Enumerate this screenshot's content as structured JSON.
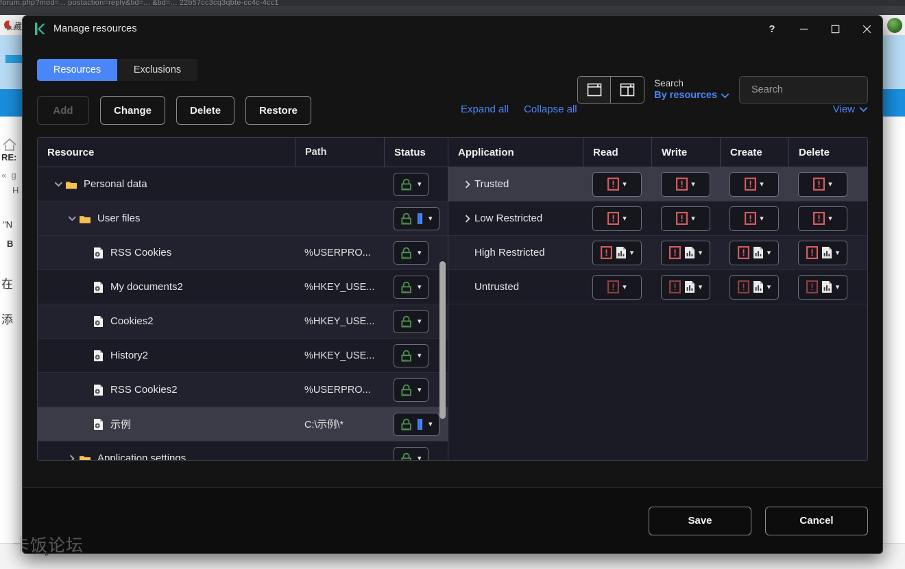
{
  "background": {
    "top_strip_text": "forum.php?mod=... postaction=reply&tid=... &tid=... 22b57cc3cq3qbte-cc4c-4cc1",
    "favorites_label": "收藏",
    "snippets": [
      "RE:",
      "\"N",
      "B",
      "在",
      "添"
    ],
    "watermark": "卡饭论坛"
  },
  "window": {
    "title": "Manage resources",
    "logo_letter": "k",
    "controls": {
      "help": "?",
      "minimize": "—",
      "maximize": "□",
      "close": "✕"
    }
  },
  "tabs": [
    {
      "label": "Resources",
      "active": true
    },
    {
      "label": "Exclusions",
      "active": false
    }
  ],
  "search": {
    "view_single_icon": "single-pane-icon",
    "view_split_icon": "split-pane-icon",
    "label": "Search",
    "mode_value": "By resources",
    "placeholder": "Search",
    "value": ""
  },
  "actions": {
    "add": "Add",
    "add_disabled": true,
    "change": "Change",
    "delete": "Delete",
    "restore": "Restore",
    "expand_all": "Expand all",
    "collapse_all": "Collapse all",
    "view_menu": "View"
  },
  "resource_table": {
    "headers": [
      "Resource",
      "Path",
      "Status"
    ],
    "rows": [
      {
        "name": "Personal data",
        "path": "",
        "indent": 0,
        "icon": "folder-icon",
        "expander": "expanded",
        "status_icons": [
          "lock-green"
        ],
        "shade": "plain"
      },
      {
        "name": "User files",
        "path": "",
        "indent": 1,
        "icon": "folder-icon",
        "expander": "expanded",
        "status_icons": [
          "lock-green",
          "blue-bar"
        ],
        "shade": "alt"
      },
      {
        "name": "RSS Cookies",
        "path": "%USERPRO...",
        "indent": 2,
        "icon": "file-gear-icon",
        "expander": "none",
        "status_icons": [
          "lock-green"
        ],
        "shade": "alt"
      },
      {
        "name": "My documents2",
        "path": "%HKEY_USE...",
        "indent": 2,
        "icon": "file-gear-icon",
        "expander": "none",
        "status_icons": [
          "lock-green"
        ],
        "shade": "plain"
      },
      {
        "name": "Cookies2",
        "path": "%HKEY_USE...",
        "indent": 2,
        "icon": "file-gear-icon",
        "expander": "none",
        "status_icons": [
          "lock-green"
        ],
        "shade": "alt"
      },
      {
        "name": "History2",
        "path": "%HKEY_USE...",
        "indent": 2,
        "icon": "file-gear-icon",
        "expander": "none",
        "status_icons": [
          "lock-green"
        ],
        "shade": "plain"
      },
      {
        "name": "RSS Cookies2",
        "path": "%USERPRO...",
        "indent": 2,
        "icon": "file-gear-icon",
        "expander": "none",
        "status_icons": [
          "lock-green"
        ],
        "shade": "alt"
      },
      {
        "name": "示例",
        "path": "C:\\示例\\*",
        "indent": 2,
        "icon": "file-gear-icon",
        "expander": "none",
        "status_icons": [
          "lock-green",
          "blue-bar"
        ],
        "shade": "sel"
      },
      {
        "name": "Application settings",
        "path": "",
        "indent": 1,
        "icon": "folder-icon",
        "expander": "collapsed",
        "status_icons": [
          "lock-green"
        ],
        "shade": "plain"
      }
    ]
  },
  "application_table": {
    "headers": [
      "Application",
      "Read",
      "Write",
      "Create",
      "Delete"
    ],
    "rows": [
      {
        "name": "Trusted",
        "expander": "collapsed",
        "shade": "sel",
        "perms": [
          {
            "icons": [
              "alert-red"
            ]
          },
          {
            "icons": [
              "alert-red"
            ]
          },
          {
            "icons": [
              "alert-red"
            ]
          },
          {
            "icons": [
              "alert-red"
            ]
          }
        ]
      },
      {
        "name": "Low Restricted",
        "expander": "collapsed",
        "shade": "plain",
        "perms": [
          {
            "icons": [
              "alert-red"
            ]
          },
          {
            "icons": [
              "alert-red"
            ]
          },
          {
            "icons": [
              "alert-red"
            ]
          },
          {
            "icons": [
              "alert-red"
            ]
          }
        ]
      },
      {
        "name": "High Restricted",
        "expander": "none",
        "shade": "alt",
        "perms": [
          {
            "icons": [
              "alert-red",
              "report-icon"
            ]
          },
          {
            "icons": [
              "alert-red",
              "report-icon"
            ]
          },
          {
            "icons": [
              "alert-red",
              "report-icon"
            ]
          },
          {
            "icons": [
              "alert-red",
              "report-icon"
            ]
          }
        ]
      },
      {
        "name": "Untrusted",
        "expander": "none",
        "shade": "plain",
        "perms": [
          {
            "icons": [
              "alert-red-dim"
            ]
          },
          {
            "icons": [
              "alert-red-dim",
              "report-icon"
            ]
          },
          {
            "icons": [
              "alert-red-dim",
              "report-icon"
            ]
          },
          {
            "icons": [
              "alert-red-dim",
              "report-icon"
            ]
          }
        ]
      }
    ]
  },
  "footer": {
    "save": "Save",
    "cancel": "Cancel"
  },
  "colors": {
    "accent_blue": "#4a86f7",
    "lock_green": "#4f9a4f",
    "alert_red": "#d45c5c",
    "alert_red_dim": "#8e4040",
    "folder_yellow": "#f5c251"
  }
}
